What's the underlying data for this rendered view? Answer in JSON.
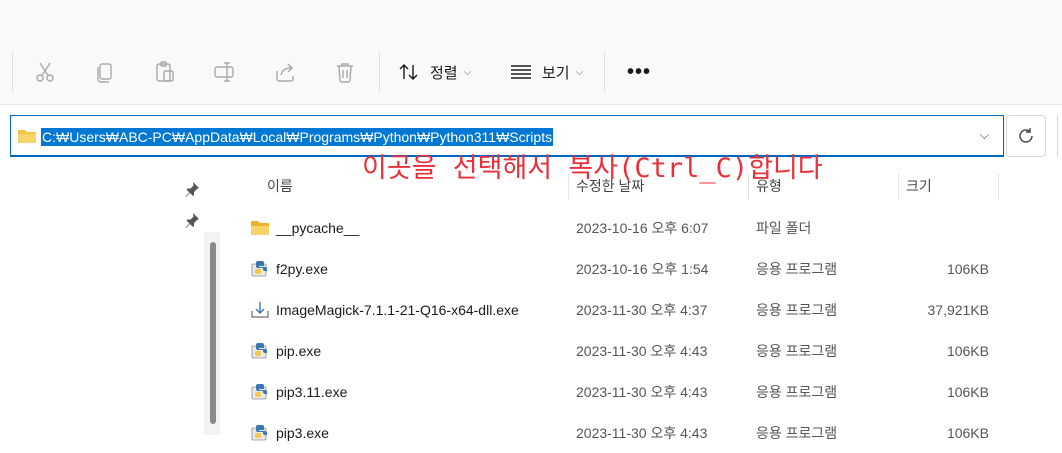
{
  "toolbar": {
    "buttons": [
      "cut-icon",
      "copy-icon",
      "paste-icon",
      "rename-icon",
      "share-icon",
      "delete-icon"
    ],
    "sort_label": "정렬",
    "view_label": "보기",
    "more_label": "•••"
  },
  "address_bar": {
    "path": "C:₩Users₩ABC-PC₩AppData₩Local₩Programs₩Python₩Python311₩Scripts"
  },
  "annotation": "이곳을 선택해서 복사(Ctrl_C)합니다",
  "columns": {
    "name": "이름",
    "date": "수정한 날짜",
    "type": "유형",
    "size": "크기"
  },
  "files": [
    {
      "name": "__pycache__",
      "date": "2023-10-16 오후 6:07",
      "type": "파일 폴더",
      "size": "",
      "icon": "folder-icon"
    },
    {
      "name": "f2py.exe",
      "date": "2023-10-16 오후 1:54",
      "type": "응용 프로그램",
      "size": "106KB",
      "icon": "python-exe-icon"
    },
    {
      "name": "ImageMagick-7.1.1-21-Q16-x64-dll.exe",
      "date": "2023-11-30 오후 4:37",
      "type": "응용 프로그램",
      "size": "37,921KB",
      "icon": "installer-icon"
    },
    {
      "name": "pip.exe",
      "date": "2023-11-30 오후 4:43",
      "type": "응용 프로그램",
      "size": "106KB",
      "icon": "python-exe-icon"
    },
    {
      "name": "pip3.11.exe",
      "date": "2023-11-30 오후 4:43",
      "type": "응용 프로그램",
      "size": "106KB",
      "icon": "python-exe-icon"
    },
    {
      "name": "pip3.exe",
      "date": "2023-11-30 오후 4:43",
      "type": "응용 프로그램",
      "size": "106KB",
      "icon": "python-exe-icon"
    }
  ],
  "colors": {
    "accent": "#0078d4",
    "annotation": "#e8303a",
    "folder": "#f3c343"
  }
}
